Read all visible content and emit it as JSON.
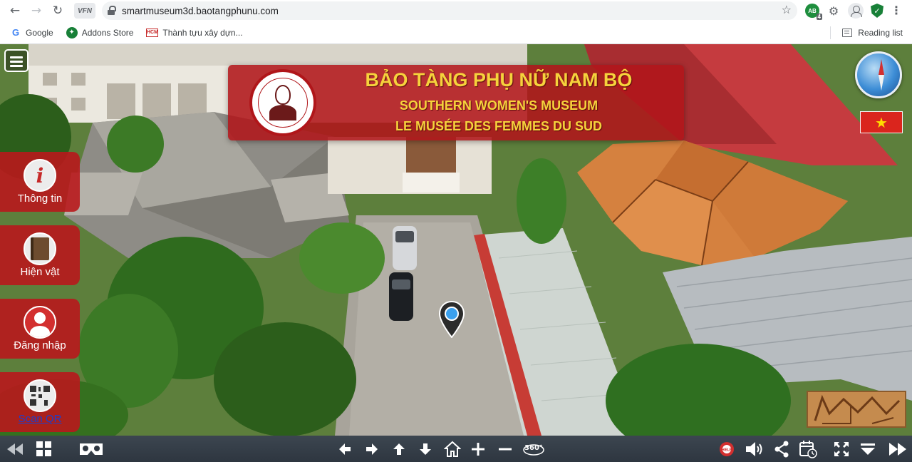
{
  "browser": {
    "url": "smartmuseum3d.baotangphunu.com",
    "ext_vfn_label": "VFN",
    "ext_ab_label": "AB",
    "ext_ab_badge": "4",
    "bookmarks": [
      {
        "label": "Google",
        "icon": "google-icon"
      },
      {
        "label": "Addons Store",
        "icon": "addons-store-icon"
      },
      {
        "label": "Thành tựu xây dựn...",
        "icon": "hcm-city-icon"
      }
    ],
    "reading_list_label": "Reading list"
  },
  "banner": {
    "line1": "BẢO TÀNG PHỤ NỮ NAM BỘ",
    "line2": "SOUTHERN WOMEN'S MUSEUM",
    "line3": "LE MUSÉE DES FEMMES DU SUD"
  },
  "sidebar": {
    "items": [
      {
        "label": "Thông tin",
        "icon": "info-icon"
      },
      {
        "label": "Hiện vật",
        "icon": "artifact-icon"
      },
      {
        "label": "Đăng nhập",
        "icon": "user-icon"
      },
      {
        "label": "Scan QR",
        "icon": "qr-icon"
      }
    ]
  },
  "flag": {
    "star": "★",
    "country": "Vietnam",
    "color": "#da251d"
  },
  "toolbar": {
    "left": [
      "prev-scene-icon",
      "thumbnails-icon",
      "vr-icon"
    ],
    "center": [
      "pan-left-icon",
      "pan-right-icon",
      "pan-up-icon",
      "pan-down-icon",
      "home-icon",
      "zoom-in-icon",
      "zoom-out-icon",
      "rotate-360-icon"
    ],
    "right": [
      "help-icon",
      "sound-icon",
      "share-icon",
      "calendar-icon",
      "fullscreen-icon",
      "dropdown-icon",
      "next-scene-icon"
    ],
    "rotate_label": "360°",
    "help_label": "HELP"
  },
  "colors": {
    "banner_red": "#b0161a",
    "banner_text": "#f6d23c",
    "toolbar_bg": "#2e3640"
  }
}
